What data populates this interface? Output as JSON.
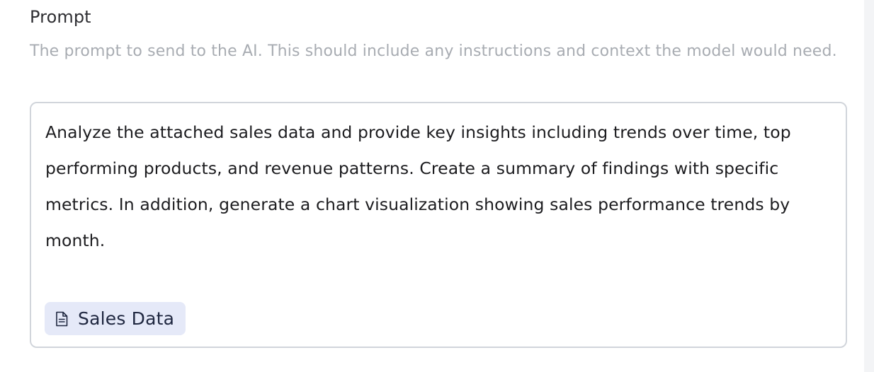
{
  "prompt_field": {
    "label": "Prompt",
    "help_text": "The prompt to send to the AI. This should include any instructions and context the model would need.",
    "value": "Analyze the attached sales data and provide key insights including trends over time, top performing products, and revenue patterns. Create a summary of findings with specific metrics. In addition, generate a chart visualization showing sales performance trends by month.",
    "attachments": [
      {
        "label": "Sales Data",
        "icon": "document-icon"
      }
    ]
  },
  "colors": {
    "label": "#2f2f33",
    "help_text": "#a8acb2",
    "border": "#d1d5db",
    "chip_background": "#e5e9f8",
    "chip_text": "#1f2740"
  }
}
